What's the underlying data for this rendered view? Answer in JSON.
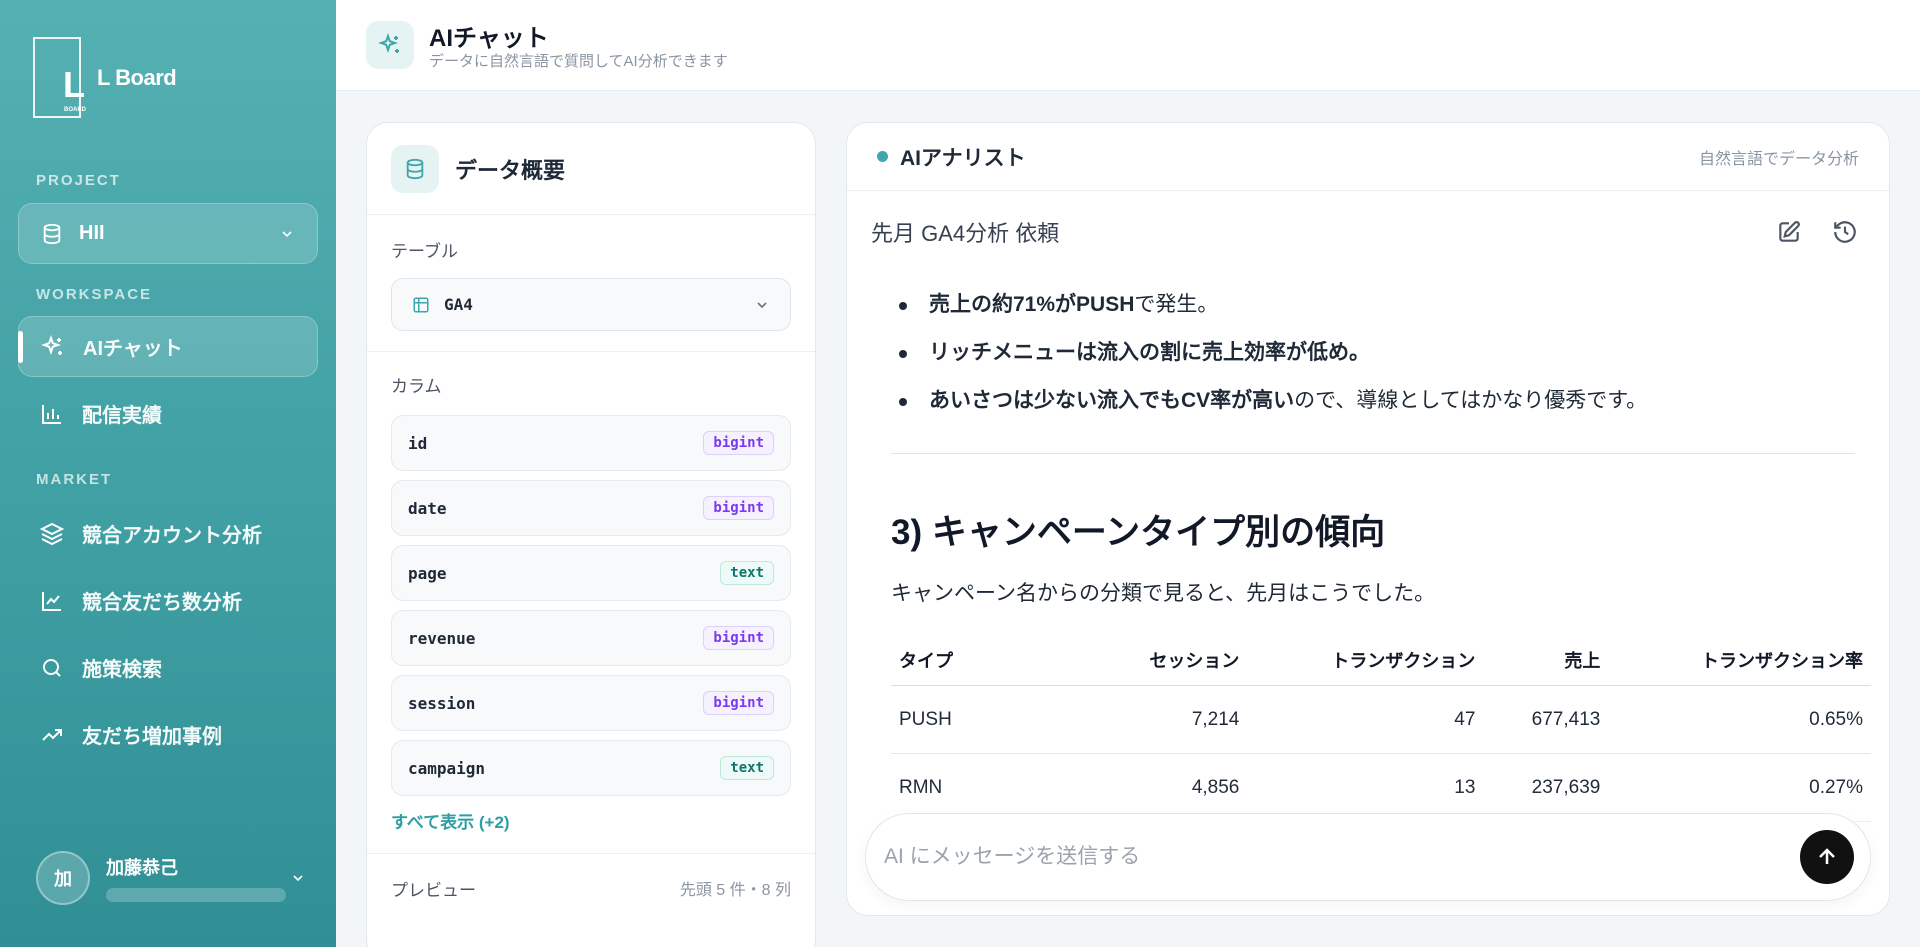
{
  "sidebar": {
    "logo_letter": "L",
    "logo_sub": "BOARD",
    "logo_text": "L Board",
    "project_label": "PROJECT",
    "project_name": "HII",
    "workspace_label": "WORKSPACE",
    "market_label": "MARKET",
    "items": [
      {
        "label": "AIチャット"
      },
      {
        "label": "配信実績"
      },
      {
        "label": "競合アカウント分析"
      },
      {
        "label": "競合友だち数分析"
      },
      {
        "label": "施策検索"
      },
      {
        "label": "友だち増加事例"
      }
    ],
    "user": {
      "initial": "加",
      "name": "加藤恭己"
    }
  },
  "header": {
    "title": "AIチャット",
    "subtitle": "データに自然言語で質問してAI分析できます"
  },
  "data_panel": {
    "title": "データ概要",
    "table_label": "テーブル",
    "table_name": "GA4",
    "column_label": "カラム",
    "columns": [
      {
        "name": "id",
        "type": "bigint"
      },
      {
        "name": "date",
        "type": "bigint"
      },
      {
        "name": "page",
        "type": "text"
      },
      {
        "name": "revenue",
        "type": "bigint"
      },
      {
        "name": "session",
        "type": "bigint"
      },
      {
        "name": "campaign",
        "type": "text"
      }
    ],
    "show_all": "すべて表示 (+2)",
    "preview_label": "プレビュー",
    "preview_meta": "先頭 5 件・8 列"
  },
  "chat": {
    "title": "AIアナリスト",
    "subtitle": "自然言語でデータ分析",
    "conversation_title": "先月 GA4分析 依頼",
    "bullets": [
      {
        "bold": "売上の約71%がPUSH",
        "rest": "で発生。"
      },
      {
        "bold": "リッチメニューは流入の割に売上効率が低め。",
        "rest": ""
      },
      {
        "bold": "あいさつは少ない流入でもCV率が高い",
        "rest": "ので、導線としてはかなり優秀です。"
      }
    ],
    "section_heading": "3) キャンペーンタイプ別の傾向",
    "section_text": "キャンペーン名からの分類で見ると、先月はこうでした。",
    "table": {
      "headers": [
        "タイプ",
        "セッション",
        "トランザクション",
        "売上",
        "トランザクション率"
      ],
      "rows": [
        [
          "PUSH",
          "7,214",
          "47",
          "677,413",
          "0.65%"
        ],
        [
          "RMN",
          "4,856",
          "13",
          "237,639",
          "0.27%"
        ]
      ]
    },
    "input_placeholder": "AI にメッセージを送信する"
  }
}
